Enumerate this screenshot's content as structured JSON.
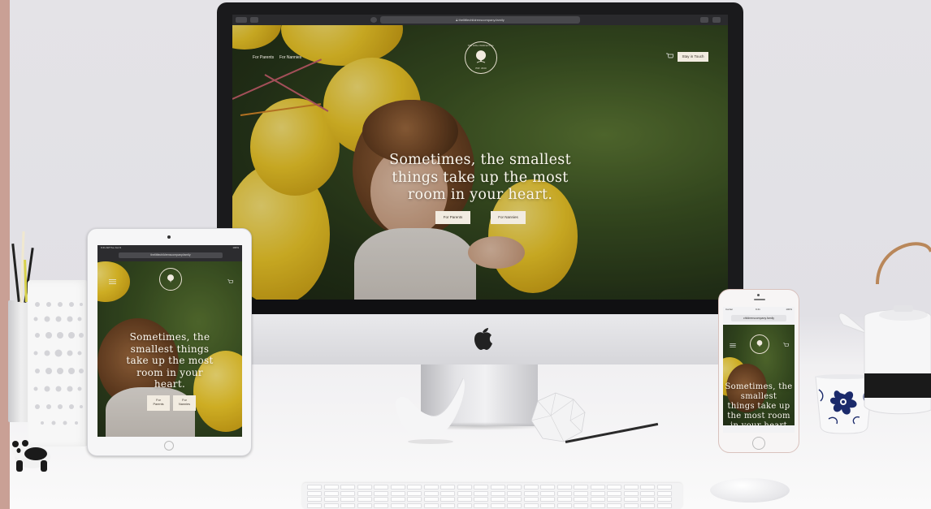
{
  "site": {
    "domain": "thelittlechildrenscompany.family",
    "mobile_domain": "childrenscompany.family",
    "nav_left": [
      "For Parents",
      "For Nannies"
    ],
    "nav_right_button": "Stay in Touch",
    "hero_headline_lines": [
      "Sometimes, the smallest",
      "things take up the most",
      "room in your heart."
    ],
    "tablet_headline_lines": [
      "Sometimes, the",
      "smallest things",
      "take up the most",
      "room in your",
      "heart."
    ],
    "phone_headline_lines": [
      "Sometimes, the",
      "smallest",
      "things take up",
      "the most room",
      "in your heart"
    ],
    "cta_primary": "For Parents",
    "cta_secondary": "For Nannies",
    "tablet_cta_primary_lines": [
      "For",
      "Parents"
    ],
    "tablet_cta_secondary_lines": [
      "For",
      "Nannies"
    ],
    "logo_ring_text": "The Little Children's Co.",
    "logo_est": "EST. 2020"
  },
  "tablet_status": {
    "left": "9:41 AM Tue Jan 9",
    "right": "100%"
  },
  "phone_status": {
    "left": "Carrier",
    "center": "9:41",
    "right": "100%"
  },
  "colors": {
    "accent_strip": "#c9a095",
    "button_bg": "#f2ece1",
    "balloon": "#f2cc2a"
  },
  "icons": [
    "apple-logo-icon",
    "cart-icon",
    "hamburger-icon",
    "lock-icon",
    "reload-icon",
    "tree-logo-icon"
  ]
}
